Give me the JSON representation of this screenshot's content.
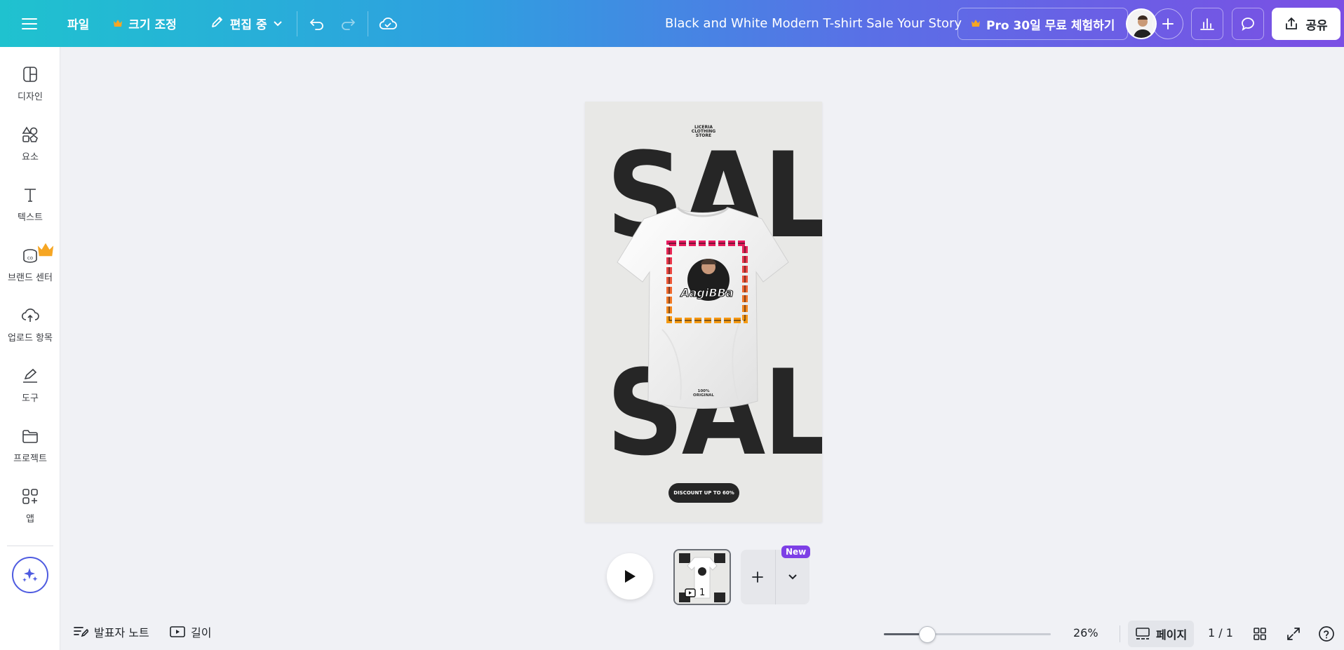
{
  "topbar": {
    "file_label": "파일",
    "resize_label": "크기 조정",
    "editing_label": "편집 중",
    "doc_title": "Black and White Modern T-shirt Sale Your Story",
    "pro_label": "Pro 30일 무료 체험하기",
    "share_label": "공유"
  },
  "sidebar": {
    "items": [
      {
        "label": "디자인",
        "icon": "design-icon"
      },
      {
        "label": "요소",
        "icon": "elements-icon"
      },
      {
        "label": "텍스트",
        "icon": "text-icon"
      },
      {
        "label": "브랜드 센터",
        "icon": "brand-icon"
      },
      {
        "label": "업로드 항목",
        "icon": "upload-icon"
      },
      {
        "label": "도구",
        "icon": "tools-icon"
      },
      {
        "label": "프로젝트",
        "icon": "folder-icon"
      },
      {
        "label": "앱",
        "icon": "apps-icon"
      }
    ]
  },
  "canvas": {
    "store_line1": "LICERIA",
    "store_line2": "CLOTHING",
    "store_line3": "STORE",
    "sale_top": "SALE",
    "sale_bottom": "SALE",
    "logo_text": "AagiBBa",
    "orig_line1": "100%",
    "orig_line2": "ORIGINAL",
    "discount": "DISCOUNT UP TO 60%"
  },
  "pages": {
    "thumb_number": "1",
    "new_badge": "New"
  },
  "bottombar": {
    "notes_label": "발표자 노트",
    "duration_label": "길이",
    "zoom_value": "26%",
    "zoom_fraction": 0.26,
    "pages_label": "페이지",
    "page_count": "1 / 1"
  },
  "colors": {
    "accent": "#7d3fe6",
    "gradient_start": "#1fc2cf",
    "gradient_end": "#7b4fe4",
    "crown": "#f6a623",
    "frame_top": "#e5195e",
    "frame_bottom": "#f59a12"
  }
}
